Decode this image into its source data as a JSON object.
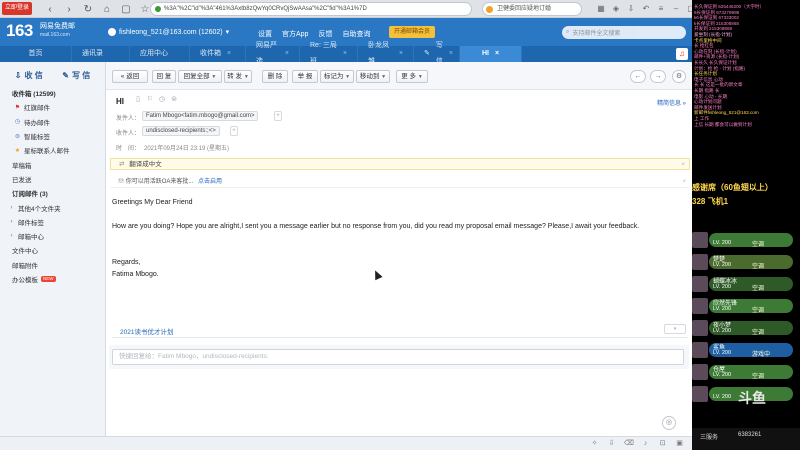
{
  "browser": {
    "badge": "立即登录",
    "url": "%3A\"%2C\"id\"%3A\"461%3Axtb8zQwYq0CRvQjSwAAsa\"%2C\"fid\"%3A1%7D",
    "news_text": "卫健委回应疑地订婚",
    "icons": [
      "star-icon",
      "bookmark-icon",
      "extension-icon",
      "game-icon",
      "download-icon",
      "more-icon"
    ]
  },
  "header": {
    "logo_number": "163",
    "logo_title": "网易免费邮",
    "logo_sub": "mail.163.com",
    "account": "fishleong_521@163.com (12602)",
    "links": [
      "设置",
      "官方App",
      "反馈",
      "自助查询"
    ],
    "vip_label": "开通邮箱会员",
    "search_placeholder": "支持邮件全文搜索"
  },
  "tabs": [
    {
      "label": "首页",
      "active": false
    },
    {
      "label": "通讯录",
      "active": false
    },
    {
      "label": "应用中心",
      "active": false
    },
    {
      "label": "收件箱",
      "active": false
    },
    {
      "label": "网易严选",
      "active": false
    },
    {
      "label": "Re: 三局 班...",
      "active": false
    },
    {
      "label": "卧龙凤雏",
      "active": false
    },
    {
      "label": "写信",
      "active": false
    },
    {
      "label": "HI",
      "active": true
    }
  ],
  "sidebar": {
    "receive": "收 信",
    "compose": "写 信",
    "items": [
      {
        "label": "收件箱 (12599)",
        "icon": "",
        "bold": true,
        "kind": "item"
      },
      {
        "label": "红旗邮件",
        "icon": "flag-icon",
        "kind": "sub"
      },
      {
        "label": "待办邮件",
        "icon": "clock-icon",
        "kind": "sub"
      },
      {
        "label": "智能标签",
        "icon": "tag-icon",
        "kind": "sub"
      },
      {
        "label": "星标联系人邮件",
        "icon": "star-icon",
        "kind": "sub"
      },
      {
        "label": "草稿箱",
        "icon": "",
        "kind": "item"
      },
      {
        "label": "已发送",
        "icon": "",
        "kind": "item"
      },
      {
        "label": "订阅邮件 (3)",
        "icon": "",
        "bold": true,
        "kind": "item"
      },
      {
        "label": "其他4个文件夹",
        "icon": "expand-icon",
        "kind": "group"
      },
      {
        "label": "邮件标签",
        "icon": "expand-icon",
        "kind": "group"
      },
      {
        "label": "邮箱中心",
        "icon": "expand-icon",
        "kind": "group"
      },
      {
        "label": "文件中心",
        "icon": "",
        "kind": "item"
      },
      {
        "label": "邮箱附件",
        "icon": "",
        "kind": "item"
      },
      {
        "label": "办公模板",
        "icon": "",
        "kind": "item",
        "badge": "NEW"
      }
    ]
  },
  "toolbar": {
    "back": "« 返回",
    "reply": "回 复",
    "reply_all": "回复全部",
    "forward": "转 发",
    "delete": "删 除",
    "report": "举 报",
    "mark": "标记为",
    "move": "移动到",
    "more": "更 多"
  },
  "mail": {
    "subject": "HI",
    "detail_link": "精简信息 »",
    "from_label": "发件人：",
    "from_value": "Fatim Mbogo<fatim.mbogo@gmail.com>",
    "to_label": "收件人：",
    "to_value": "undisclosed-recipients:;<>",
    "time_label": "时　间：",
    "time_value": "2021年09月24日 23:19 (星期五)",
    "translate": "翻译成中文",
    "notice": "你可以用活跃OA来客批...",
    "notice_link": "点击启用",
    "body": [
      "Greetings My Dear Friend",
      "How are you doing? Hope you are alright,I sent you a message earlier but no response from you, did you read my proposal email message? Please,I await your feedback.",
      "Regards,",
      "Fatima Mbogo."
    ],
    "signature_link": "2021读书优才计划",
    "reply_placeholder": "快捷回复给：Fatim Mbogo，undisclosed-recipients:"
  },
  "overlay": {
    "lines": [
      {
        "text": "长久保证到 625446200（大学时）",
        "color": "#ff7ec8"
      },
      {
        "text": "6长保证到 673279998",
        "color": "#ff7ec8"
      },
      {
        "text": "k6长保证到 67333002",
        "color": "#ff7ec8"
      },
      {
        "text": "k长保证到 215308868",
        "color": "#ff7ec8"
      },
      {
        "text": "开发到 215308868",
        "color": "#ff7ec8"
      },
      {
        "text": "爱坐刻 (长指-计划)",
        "color": "#ffb0e0"
      },
      {
        "text": "卡点里格中间",
        "color": "#ffdd55"
      },
      {
        "text": "长 抢红包",
        "color": "#ff7ec8"
      },
      {
        "text": "心动在刻 (长指-计划)",
        "color": "#ff7ec8"
      },
      {
        "text": "邮件+资源 (长指-计划)",
        "color": "#ff7ec8"
      },
      {
        "text": "长长久 长久保证计划",
        "color": "#ff7ec8"
      },
      {
        "text": "计划：抢 抢 - 计划 (指路)",
        "color": "#ff7ec8"
      },
      {
        "text": "长任务计划",
        "color": "#ffdd55"
      },
      {
        "text": "电子信息 心动",
        "color": "#ff7ec8"
      },
      {
        "text": "长 长 这是一批的新文章",
        "color": "#ff7ec8"
      },
      {
        "text": "长期 指路 长",
        "color": "#ff7ec8"
      },
      {
        "text": "电影 心动 - 长期",
        "color": "#ff7ec8"
      },
      {
        "text": "心动计划问题",
        "color": "#ff7ec8"
      },
      {
        "text": "邮件发送计划",
        "color": "#ff7ec8"
      },
      {
        "text": "新邮件fishleong_521@163.com",
        "color": "#ffdd55"
      },
      {
        "text": "上 工作",
        "color": "#ff7ec8"
      },
      {
        "text": "上信 长期 都会可以做到计划",
        "color": "#ff7ec8"
      }
    ],
    "big1": "感谢席（60鱼翅以上）",
    "big2": "328 飞机1",
    "users": [
      {
        "name": "",
        "level": "LV. 200",
        "tag": "空调",
        "color": "#3c7a36"
      },
      {
        "name": "楚楚",
        "level": "LV. 200",
        "tag": "空调",
        "color": "#4a6a2e"
      },
      {
        "name": "蝴蝶冰冰",
        "level": "LV. 200",
        "tag": "空调",
        "color": "#2e5a28"
      },
      {
        "name": "欣然先锋",
        "level": "LV. 200",
        "tag": "空调",
        "color": "#3c7a36"
      },
      {
        "name": "夜小梦",
        "level": "LV. 200",
        "tag": "空调",
        "color": "#2e5a28"
      },
      {
        "name": "鲨鱼",
        "level": "LV. 200",
        "tag": "游戏中",
        "color": "#1e5fa4"
      },
      {
        "name": "仓屋",
        "level": "LV. 200",
        "tag": "空调",
        "color": "#3c7a36"
      },
      {
        "name": "",
        "level": "LV. 200",
        "tag": "",
        "color": "#3c7a36"
      }
    ],
    "bottom_left": "三服务",
    "bottom_mid": "6383261",
    "logo": "斗鱼"
  }
}
